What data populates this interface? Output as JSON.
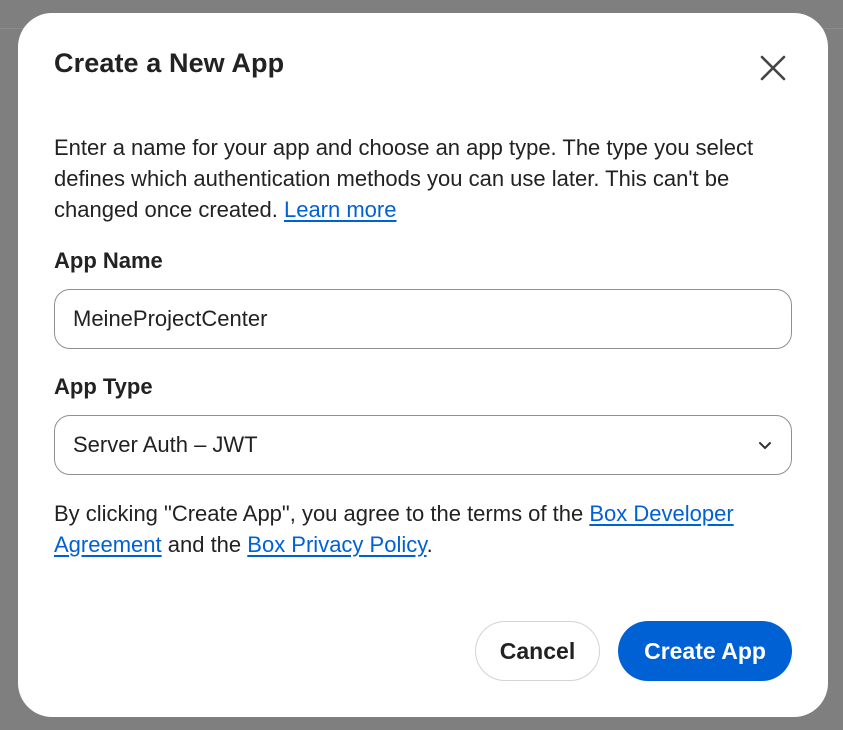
{
  "dialog": {
    "title": "Create a New App",
    "close_icon": "close-icon",
    "description": {
      "text": "Enter a name for your app and choose an app type. The type you select defines which authentication methods you can use later. This can't be changed once created.",
      "link_label": "Learn more"
    }
  },
  "form": {
    "app_name": {
      "label": "App Name",
      "value": "MeineProjectCenter"
    },
    "app_type": {
      "label": "App Type",
      "selected": "Server Auth – JWT",
      "chevron_icon": "chevron-down-icon"
    }
  },
  "agreement": {
    "prefix": "By clicking \"Create App\", you agree to the terms of the",
    "developer_agreement_link": "Box Developer Agreement",
    "middle": "and the",
    "privacy_policy_link": "Box Privacy Policy",
    "suffix": "."
  },
  "actions": {
    "cancel_label": "Cancel",
    "create_label": "Create App"
  },
  "colors": {
    "accent": "#0061d5",
    "text": "#222222",
    "backdrop": "#7f7f7f",
    "surface": "#ffffff"
  }
}
